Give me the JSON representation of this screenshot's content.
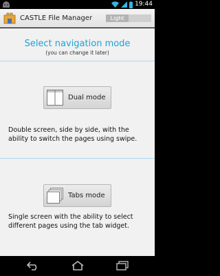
{
  "status_bar": {
    "time": "19:44"
  },
  "action_bar": {
    "title": "CASTLE File Manager",
    "theme_toggle": "Light"
  },
  "main": {
    "heading": "Select navigation mode",
    "subheading": "(you can change it later)",
    "modes": [
      {
        "label": "Dual mode",
        "description": "Double screen, side by side, with the ability to switch the pages using swipe."
      },
      {
        "label": "Tabs mode",
        "description": "Single screen with the ability to select different pages using the tab widget."
      }
    ]
  },
  "nav_bar": {
    "icons": [
      "back-icon",
      "home-icon",
      "recents-icon"
    ]
  },
  "colors": {
    "accent": "#1BA3DA",
    "background": "#F1F1F1",
    "divider": "#A9D8EE"
  }
}
